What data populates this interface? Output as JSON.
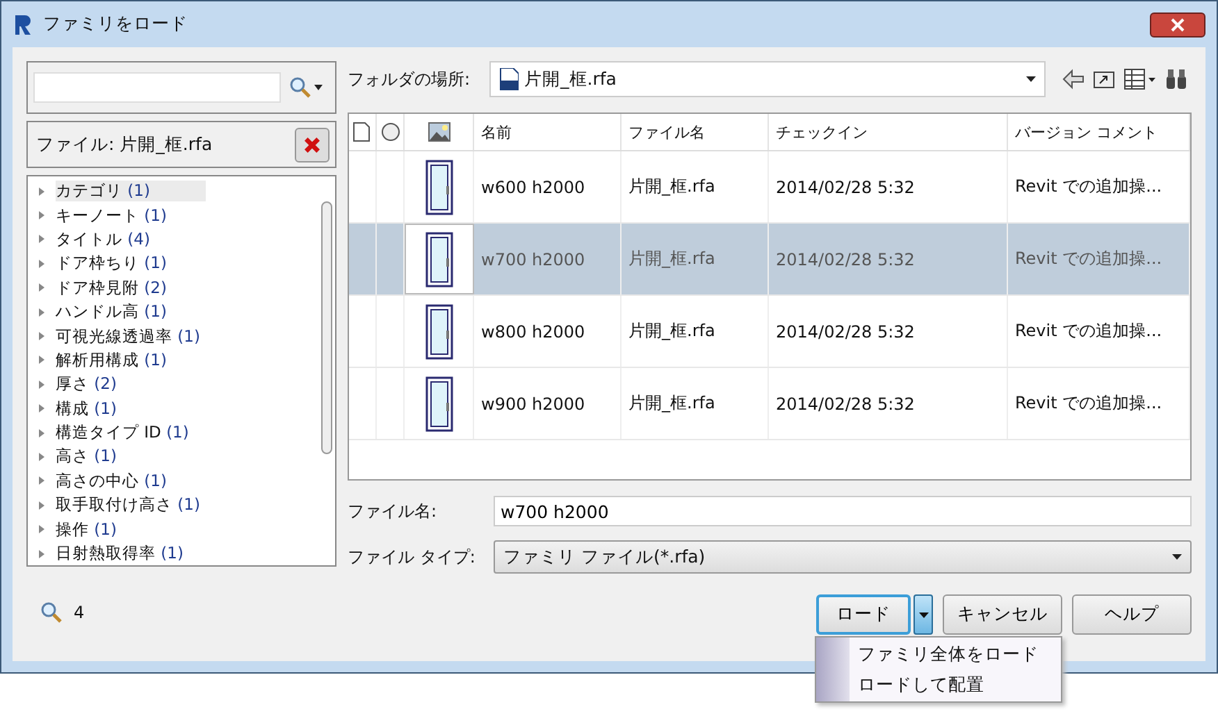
{
  "window": {
    "title": "ファミリをロード"
  },
  "filter": {
    "label": "ファイル: 片開_框.rfa"
  },
  "tree": [
    {
      "label": "カテゴリ",
      "count": "(1)",
      "selected": true,
      "expanded": false
    },
    {
      "label": "キーノート",
      "count": "(1)",
      "selected": false,
      "expanded": false
    },
    {
      "label": "タイトル",
      "count": "(4)",
      "selected": false,
      "expanded": false
    },
    {
      "label": "ドア枠ちり",
      "count": "(1)",
      "selected": false,
      "expanded": false
    },
    {
      "label": "ドア枠見附",
      "count": "(2)",
      "selected": false,
      "expanded": false
    },
    {
      "label": "ハンドル高",
      "count": "(1)",
      "selected": false,
      "expanded": false
    },
    {
      "label": "可視光線透過率",
      "count": "(1)",
      "selected": false,
      "expanded": false
    },
    {
      "label": "解析用構成",
      "count": "(1)",
      "selected": false,
      "expanded": false
    },
    {
      "label": "厚さ",
      "count": "(2)",
      "selected": false,
      "expanded": false
    },
    {
      "label": "構成",
      "count": "(1)",
      "selected": false,
      "expanded": false
    },
    {
      "label": "構造タイプ ID",
      "count": "(1)",
      "selected": false,
      "expanded": false
    },
    {
      "label": "高さ",
      "count": "(1)",
      "selected": false,
      "expanded": false
    },
    {
      "label": "高さの中心",
      "count": "(1)",
      "selected": false,
      "expanded": false
    },
    {
      "label": "取手取付け高さ",
      "count": "(1)",
      "selected": false,
      "expanded": false
    },
    {
      "label": "操作",
      "count": "(1)",
      "selected": false,
      "expanded": false
    },
    {
      "label": "日射熱取得率",
      "count": "(1)",
      "selected": false,
      "expanded": false
    }
  ],
  "result_count": "4",
  "folder": {
    "label": "フォルダの場所:",
    "value": "片開_框.rfa"
  },
  "table": {
    "columns": [
      "名前",
      "ファイル名",
      "チェックイン",
      "バージョン コメント"
    ],
    "rows": [
      {
        "name": "w600 h2000",
        "file": "片開_框.rfa",
        "checkin": "2014/02/28 5:32",
        "comment": "Revit での追加操...",
        "selected": false
      },
      {
        "name": "w700 h2000",
        "file": "片開_框.rfa",
        "checkin": "2014/02/28 5:32",
        "comment": "Revit での追加操...",
        "selected": true
      },
      {
        "name": "w800 h2000",
        "file": "片開_框.rfa",
        "checkin": "2014/02/28 5:32",
        "comment": "Revit での追加操...",
        "selected": false
      },
      {
        "name": "w900 h2000",
        "file": "片開_框.rfa",
        "checkin": "2014/02/28 5:32",
        "comment": "Revit での追加操...",
        "selected": false
      }
    ]
  },
  "file_name": {
    "label": "ファイル名:",
    "value": "w700 h2000"
  },
  "file_type": {
    "label": "ファイル タイプ:",
    "value": "ファミリ ファイル(*.rfa)"
  },
  "buttons": {
    "load": "ロード",
    "cancel": "キャンセル",
    "help": "ヘルプ"
  },
  "load_menu": {
    "open": true,
    "items": [
      "ファミリ全体をロード",
      "ロードして配置"
    ]
  }
}
